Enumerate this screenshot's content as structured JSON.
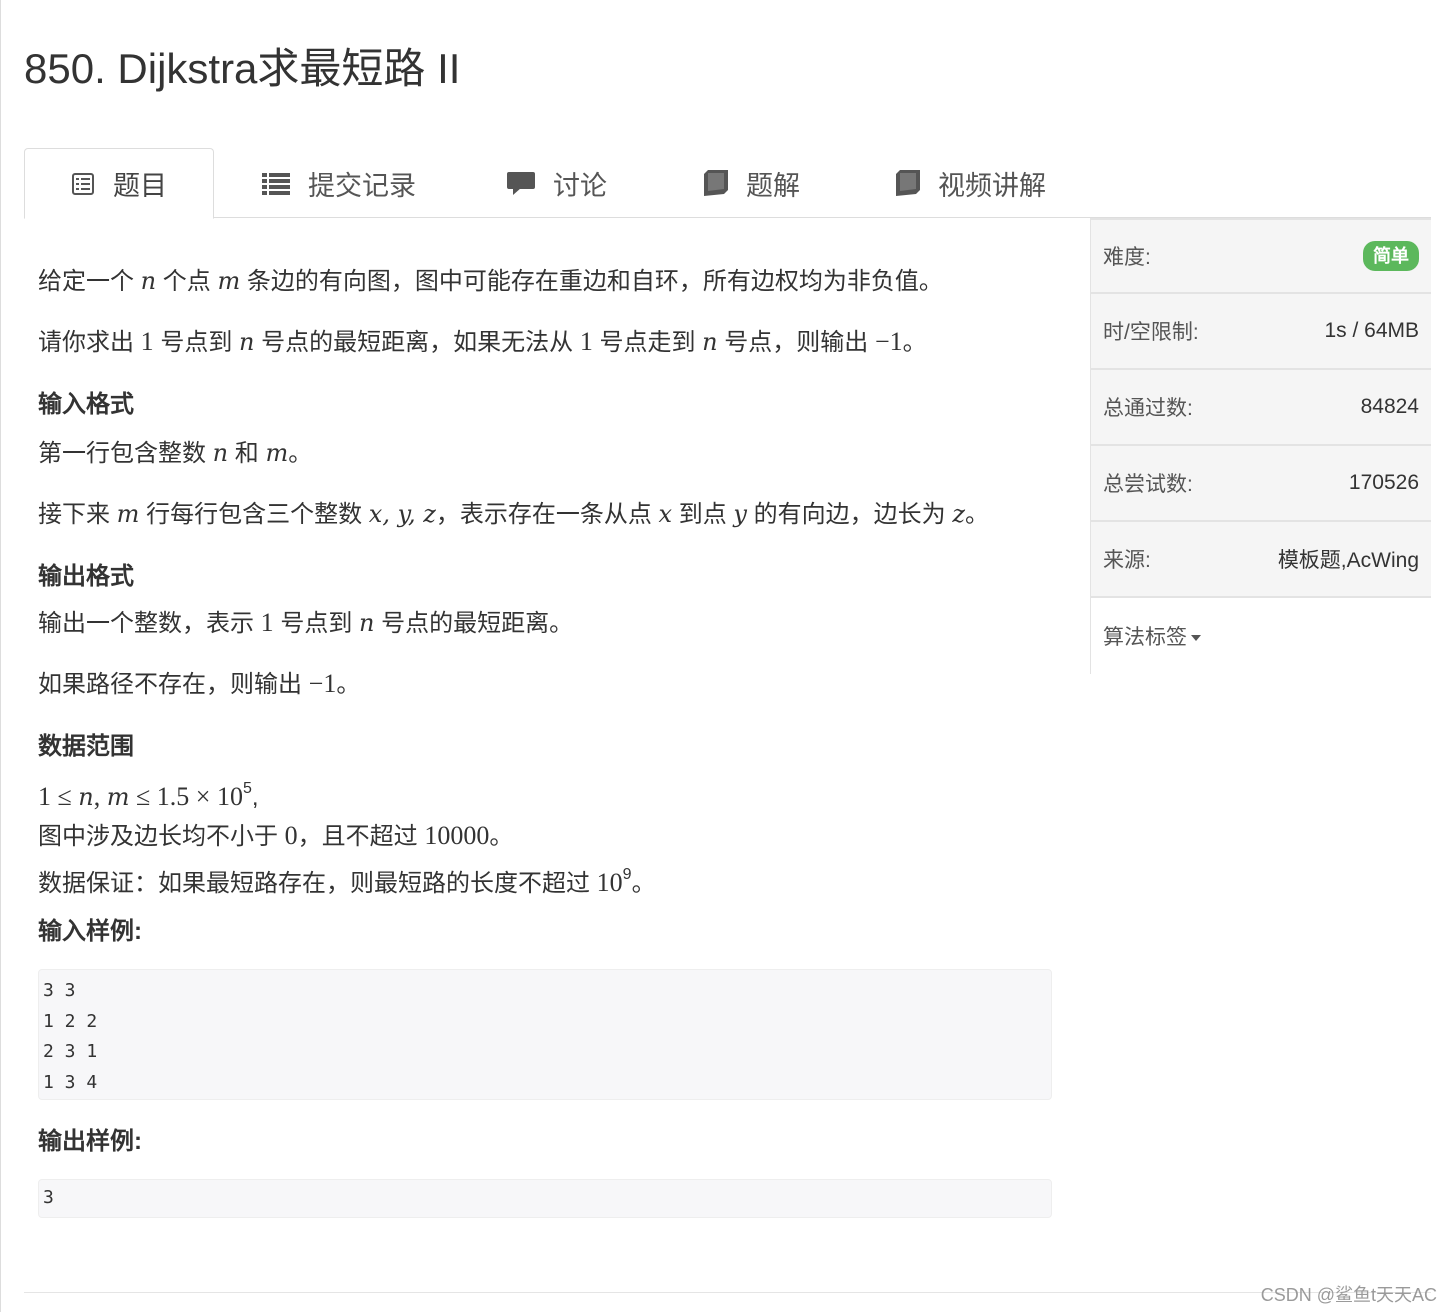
{
  "page": {
    "title": "850. Dijkstra求最短路 II"
  },
  "tabs": [
    {
      "label": "题目",
      "icon": "list-alt-icon",
      "active": true
    },
    {
      "label": "提交记录",
      "icon": "list-icon"
    },
    {
      "label": "讨论",
      "icon": "comment-icon"
    },
    {
      "label": "题解",
      "icon": "book-icon"
    },
    {
      "label": "视频讲解",
      "icon": "book-icon"
    }
  ],
  "problem": {
    "desc1": {
      "a": "给定一个 ",
      "v1": "n",
      "b": " 个点 ",
      "v2": "m",
      "c": " 条边的有向图，图中可能存在重边和自环，所有边权均为非负值。"
    },
    "desc2": {
      "a": "请你求出 ",
      "n1": "1",
      "b": " 号点到 ",
      "v1": "n",
      "c": " 号点的最短距离，如果无法从 ",
      "n2": "1",
      "d": " 号点走到 ",
      "v2": "n",
      "e": " 号点，则输出 ",
      "n3": "−1",
      "f": "。"
    },
    "input_heading": "输入格式",
    "input1": {
      "a": "第一行包含整数 ",
      "v1": "n",
      "b": " 和 ",
      "v2": "m",
      "c": "。"
    },
    "input2": {
      "a": "接下来 ",
      "v1": "m",
      "b": " 行每行包含三个整数 ",
      "v2": "x, y, z",
      "c": "，表示存在一条从点 ",
      "v3": "x",
      "d": " 到点 ",
      "v4": "y",
      "e": " 的有向边，边长为 ",
      "v5": "z",
      "f": "。"
    },
    "output_heading": "输出格式",
    "output1": {
      "a": "输出一个整数，表示 ",
      "n1": "1",
      "b": " 号点到 ",
      "v1": "n",
      "c": " 号点的最短距离。"
    },
    "output2": {
      "a": "如果路径不存在，则输出 ",
      "n1": "−1",
      "b": "。"
    },
    "range_heading": "数据范围",
    "range1": {
      "a": "1 ≤ ",
      "v1": "n",
      "b": ", ",
      "v2": "m",
      "c": " ≤ 1.5 × 10",
      "sup": "5",
      "d": ","
    },
    "range2": {
      "a": "图中涉及边长均不小于 ",
      "n1": "0",
      "b": "，且不超过 ",
      "n2": "10000",
      "c": "。"
    },
    "range3": {
      "a": "数据保证：如果最短路存在，则最短路的长度不超过 ",
      "n1": "10",
      "sup": "9",
      "b": "。"
    },
    "sample_in_heading": "输入样例:",
    "sample_in_lines": [
      "3 3",
      "1 2 2",
      "2 3 1",
      "1 3 4"
    ],
    "sample_out_heading": "输出样例:",
    "sample_out_lines": [
      "3"
    ]
  },
  "sidebar": {
    "difficulty_label": "难度:",
    "difficulty_value": "简单",
    "limit_label": "时/空限制:",
    "limit_value": "1s / 64MB",
    "passed_label": "总通过数:",
    "passed_value": "84824",
    "attempts_label": "总尝试数:",
    "attempts_value": "170526",
    "source_label": "来源:",
    "source_value": "模板题,AcWing",
    "tags_label": "算法标签"
  },
  "colors": {
    "difficulty_easy": "#5cb85c",
    "border": "#dddddd",
    "sidebar_bg": "#f5f5f5"
  },
  "watermark": "CSDN @鲨鱼t天天AC"
}
